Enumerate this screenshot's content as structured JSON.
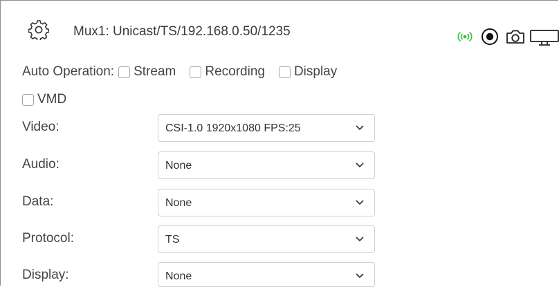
{
  "header": {
    "title": "Mux1: Unicast/TS/192.168.0.50/1235",
    "icons": [
      "gear-icon",
      "streaming-icon",
      "record-icon",
      "camera-icon",
      "display-icon"
    ],
    "stream_icon_color": "#3fbf3f"
  },
  "auto_operation": {
    "label": "Auto Operation:",
    "options": [
      {
        "label": "Stream",
        "checked": false
      },
      {
        "label": "Recording",
        "checked": false
      },
      {
        "label": "Display",
        "checked": false
      },
      {
        "label": "VMD",
        "checked": false
      }
    ]
  },
  "fields": [
    {
      "label": "Video:",
      "value": "CSI-1.0 1920x1080 FPS:25"
    },
    {
      "label": "Audio:",
      "value": "None"
    },
    {
      "label": "Data:",
      "value": "None"
    },
    {
      "label": "Protocol:",
      "value": "TS"
    },
    {
      "label": "Display:",
      "value": "None"
    }
  ]
}
